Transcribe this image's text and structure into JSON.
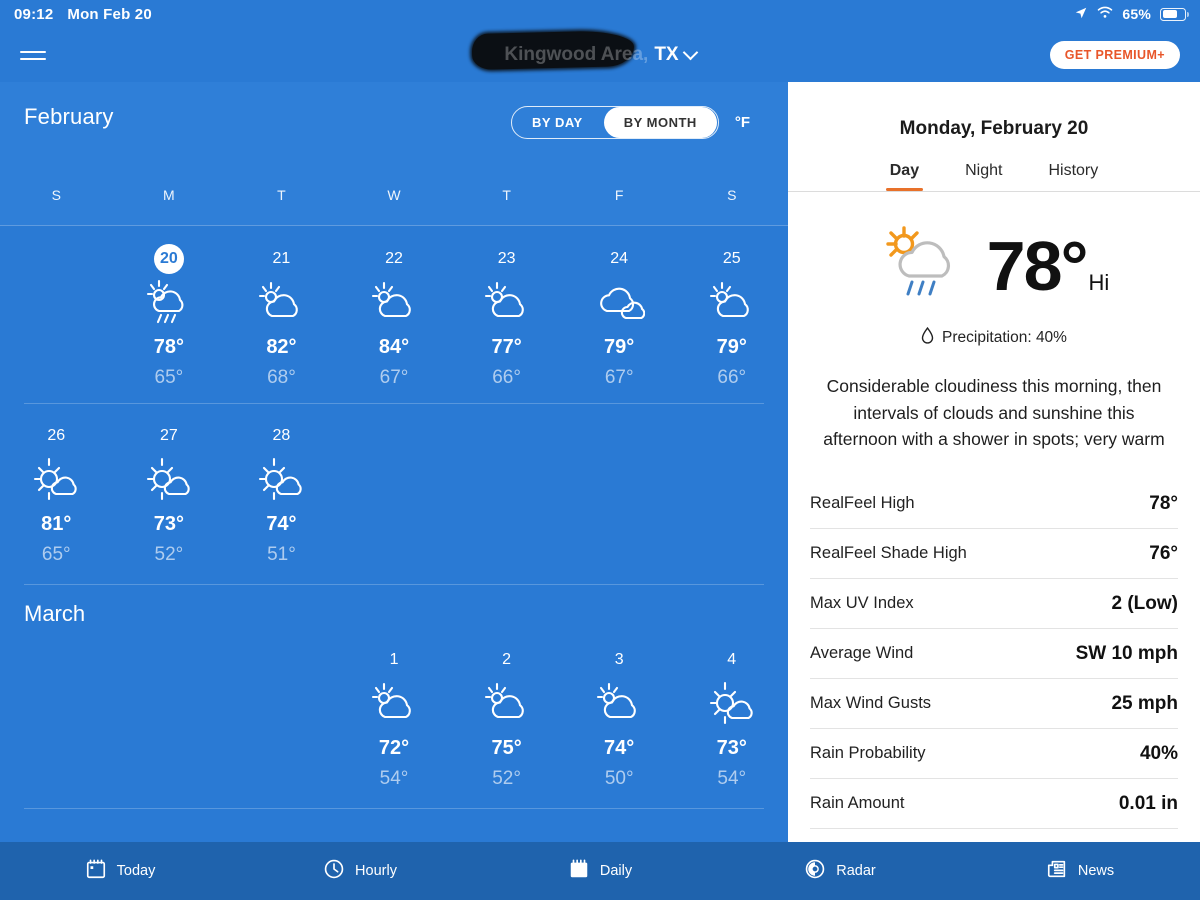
{
  "status_bar": {
    "time": "09:12",
    "date": "Mon Feb 20",
    "battery_percent": "65%",
    "icons": [
      "location-arrow-icon",
      "wifi-icon",
      "battery-icon"
    ]
  },
  "app_header": {
    "menu_icon": "hamburger-menu-icon",
    "location_name": "Kingwood Area,",
    "location_state": "TX",
    "location_dropdown_icon": "chevron-down-icon",
    "premium_label": "GET PREMIUM+"
  },
  "calendar": {
    "month_title": "February",
    "toggle": {
      "by_day": "BY DAY",
      "by_month": "BY MONTH",
      "selected": "BY MONTH"
    },
    "unit": "°F",
    "weekday_headers": [
      "S",
      "M",
      "T",
      "W",
      "T",
      "F",
      "S"
    ],
    "second_month_title": "March",
    "weeks": [
      [
        {
          "day": "",
          "empty": true
        },
        {
          "day": "20",
          "selected": true,
          "icon": "sun-cloud-rain-icon",
          "hi": "78°",
          "lo": "65°"
        },
        {
          "day": "21",
          "selected": false,
          "icon": "sun-cloud-icon",
          "hi": "82°",
          "lo": "68°"
        },
        {
          "day": "22",
          "selected": false,
          "icon": "sun-cloud-icon",
          "hi": "84°",
          "lo": "67°"
        },
        {
          "day": "23",
          "selected": false,
          "icon": "sun-cloud-icon",
          "hi": "77°",
          "lo": "66°"
        },
        {
          "day": "24",
          "selected": false,
          "icon": "cloudy-icon",
          "hi": "79°",
          "lo": "67°"
        },
        {
          "day": "25",
          "selected": false,
          "icon": "sun-cloud-icon",
          "hi": "79°",
          "lo": "66°"
        }
      ],
      [
        {
          "day": "26",
          "selected": false,
          "icon": "mostly-sunny-icon",
          "hi": "81°",
          "lo": "65°"
        },
        {
          "day": "27",
          "selected": false,
          "icon": "mostly-sunny-icon",
          "hi": "73°",
          "lo": "52°"
        },
        {
          "day": "28",
          "selected": false,
          "icon": "mostly-sunny-icon",
          "hi": "74°",
          "lo": "51°"
        },
        {
          "day": "",
          "empty": true
        },
        {
          "day": "",
          "empty": true
        },
        {
          "day": "",
          "empty": true
        },
        {
          "day": "",
          "empty": true
        }
      ]
    ],
    "march_week": [
      {
        "day": "",
        "empty": true
      },
      {
        "day": "",
        "empty": true
      },
      {
        "day": "",
        "empty": true
      },
      {
        "day": "1",
        "selected": false,
        "icon": "sun-cloud-icon",
        "hi": "72°",
        "lo": "54°"
      },
      {
        "day": "2",
        "selected": false,
        "icon": "sun-cloud-icon",
        "hi": "75°",
        "lo": "52°"
      },
      {
        "day": "3",
        "selected": false,
        "icon": "sun-cloud-icon",
        "hi": "74°",
        "lo": "50°"
      },
      {
        "day": "4",
        "selected": false,
        "icon": "mostly-sunny-icon",
        "hi": "73°",
        "lo": "54°"
      }
    ]
  },
  "detail": {
    "date_title": "Monday, February 20",
    "tabs": [
      {
        "label": "Day",
        "active": true
      },
      {
        "label": "Night",
        "active": false
      },
      {
        "label": "History",
        "active": false
      }
    ],
    "current_icon": "sun-cloud-rain-icon",
    "temperature": "78°",
    "temperature_suffix": "Hi",
    "precipitation_icon": "water-drop-icon",
    "precipitation": "Precipitation: 40%",
    "description": "Considerable cloudiness this morning, then intervals of clouds and sunshine this afternoon with a shower in spots; very warm",
    "rows": [
      {
        "key": "RealFeel High",
        "value": "78°"
      },
      {
        "key": "RealFeel Shade High",
        "value": "76°"
      },
      {
        "key": "Max UV Index",
        "value": "2 (Low)"
      },
      {
        "key": "Average Wind",
        "value": "SW 10 mph"
      },
      {
        "key": "Max Wind Gusts",
        "value": "25 mph"
      },
      {
        "key": "Rain Probability",
        "value": "40%"
      },
      {
        "key": "Rain Amount",
        "value": "0.01 in"
      }
    ]
  },
  "bottom_nav": [
    {
      "label": "Today",
      "icon": "calendar-today-icon",
      "active": false
    },
    {
      "label": "Hourly",
      "icon": "clock-icon",
      "active": false
    },
    {
      "label": "Daily",
      "icon": "calendar-daily-icon",
      "active": true
    },
    {
      "label": "Radar",
      "icon": "radar-icon",
      "active": false
    },
    {
      "label": "News",
      "icon": "newspaper-icon",
      "active": false
    }
  ],
  "colors": {
    "app_blue": "#2a7ad4",
    "header_blue": "#2f7fd8",
    "nav_blue": "#1f63ad",
    "accent_orange": "#e8712a",
    "premium_orange": "#e8562a",
    "panel_white": "#ffffff"
  }
}
